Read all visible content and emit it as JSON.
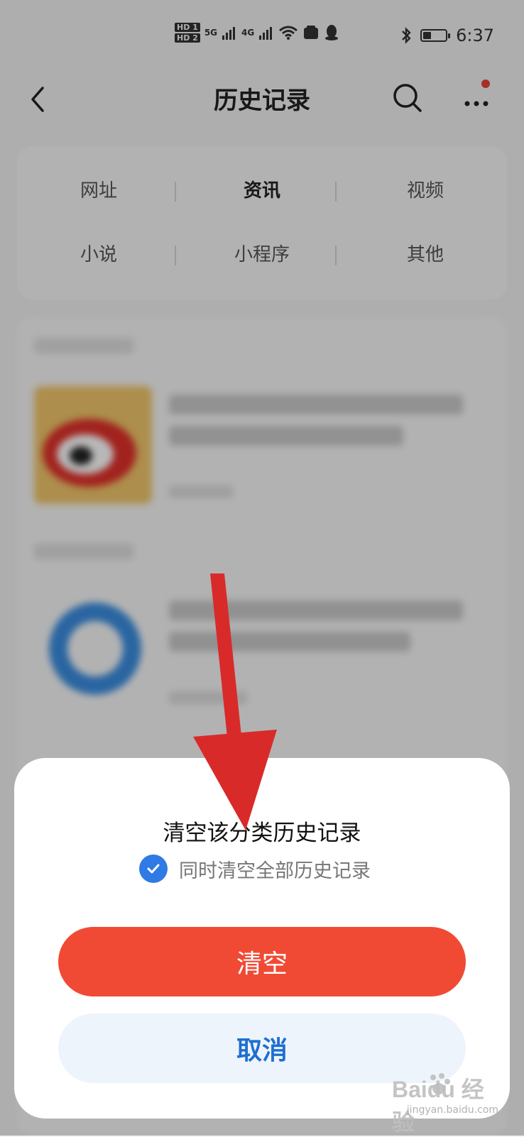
{
  "status_bar": {
    "hd1": "HD 1",
    "hd2": "HD 2",
    "net1": "5G",
    "net2": "4G",
    "time": "6:37",
    "battery_level": 0.35
  },
  "header": {
    "title": "历史记录"
  },
  "categories": [
    {
      "label": "网址",
      "active": false
    },
    {
      "label": "资讯",
      "active": true
    },
    {
      "label": "视频",
      "active": false
    },
    {
      "label": "小说",
      "active": false
    },
    {
      "label": "小程序",
      "active": false
    },
    {
      "label": "其他",
      "active": false
    }
  ],
  "dialog": {
    "title": "清空该分类历史记录",
    "checkbox_label": "同时清空全部历史记录",
    "checkbox_checked": true,
    "confirm_label": "清空",
    "cancel_label": "取消"
  },
  "watermark": {
    "main": "Baidu 经验",
    "sub": "jingyan.baidu.com"
  },
  "colors": {
    "accent_red": "#f04a35",
    "accent_blue": "#2f7ae5",
    "annotation_arrow": "#d92a2a"
  }
}
